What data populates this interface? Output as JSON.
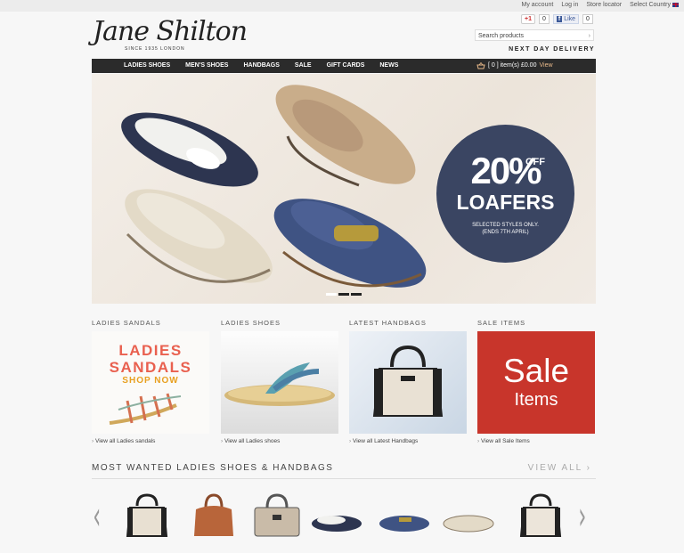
{
  "toplinks": {
    "account": "My account",
    "login": "Log in",
    "store": "Store locator",
    "country": "Select Country"
  },
  "brand": {
    "logo": "Jane Shilton",
    "sub": "SINCE 1935 LONDON"
  },
  "social": {
    "gplus": "+1",
    "gplus_count": "0",
    "like": "Like",
    "like_count": "0"
  },
  "search": {
    "placeholder": "Search products"
  },
  "tagline": "NEXT DAY DELIVERY",
  "nav": {
    "items": [
      "LADIES SHOES",
      "MEN'S SHOES",
      "HANDBAGS",
      "SALE",
      "GIFT CARDS",
      "NEWS"
    ]
  },
  "basket": {
    "text": "[ 0 ] item(s)  £0.00",
    "view": "View"
  },
  "hero": {
    "pct": "20%",
    "off": "OFF",
    "headline": "LOAFERS",
    "line1": "SELECTED STYLES ONLY.",
    "line2": "(ENDS 7TH APRIL)"
  },
  "categories": [
    {
      "title": "LADIES SANDALS",
      "link": "View all Ladies sandals",
      "img_line1": "LADIES",
      "img_line2": "SANDALS",
      "img_line3": "SHOP NOW"
    },
    {
      "title": "LADIES SHOES",
      "link": "View all Ladies shoes"
    },
    {
      "title": "LATEST HANDBAGS",
      "link": "View all Latest Handbags"
    },
    {
      "title": "SALE ITEMS",
      "link": "View all Sale Items",
      "img_line1": "Sale",
      "img_line2": "Items"
    }
  ],
  "most_wanted": {
    "title": "MOST WANTED LADIES SHOES & HANDBAGS",
    "view_all": "VIEW ALL ›"
  },
  "colors": {
    "nav_bg": "#2b2b2b",
    "badge_bg": "#3a4562",
    "sale_red": "#c8352b",
    "sandals_coral": "#e9604f",
    "shop_now": "#e8a020"
  }
}
